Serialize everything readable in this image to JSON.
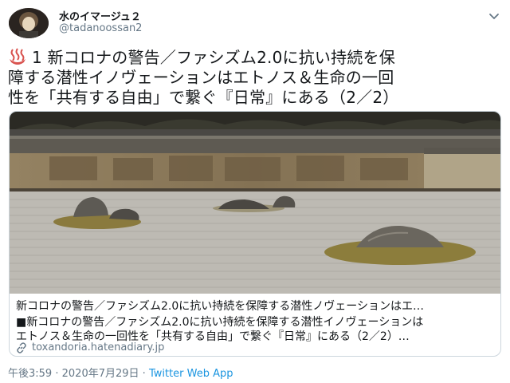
{
  "user": {
    "display_name": "水のイマージュ２",
    "handle": "@tadanoossan2"
  },
  "tweet": {
    "emoji_icon": "hot-springs-icon",
    "lines": [
      "1 新コロナの警告／ファシズム2.0に抗い持続を保",
      "障する潜性イノヴェーションはエトノス＆生命の一回",
      "性を「共有する自由」で繋ぐ『日常』にある（2／2）"
    ]
  },
  "card": {
    "title": "新コロナの警告／ファシズム2.0に抗い持続を保障する潜性ノヴェーションはエ…",
    "description_lines": [
      "■新コロナの警告／ファシズム2.0に抗い持続を保障する潜性イノヴェーションは",
      "エトノス＆生命の一回性を「共有する自由」で繋ぐ『日常』にある（2／2）…"
    ],
    "domain": "toxandoria.hatenadiary.jp"
  },
  "meta": {
    "time": "午後3:59",
    "separator": "·",
    "date": "2020年7月29日",
    "app": "Twitter Web App"
  },
  "colors": {
    "text": "#14171a",
    "secondary": "#657786",
    "link": "#1b95e0",
    "border": "#ccd6dd"
  }
}
